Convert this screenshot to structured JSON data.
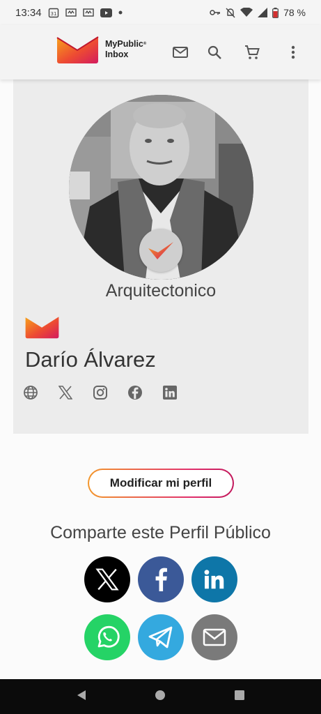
{
  "status_bar": {
    "time": "13:34",
    "battery": "78 %",
    "left_icons": [
      "calendar-icon",
      "notification-icon",
      "notification-icon",
      "youtube-icon",
      "dot-icon"
    ],
    "right_icons": [
      "key-icon",
      "mute-icon",
      "wifi-icon",
      "signal-icon",
      "battery-icon"
    ]
  },
  "app_bar": {
    "brand_line1": "MyPublic",
    "brand_reg": "®",
    "brand_line2": "Inbox",
    "actions": [
      "mail-icon",
      "search-icon",
      "cart-icon",
      "more-vert-icon"
    ]
  },
  "profile": {
    "category": "Arquitectonico",
    "name": "Darío Álvarez",
    "social_links": [
      "globe-icon",
      "x-icon",
      "instagram-icon",
      "facebook-icon",
      "linkedin-icon"
    ]
  },
  "edit_button": {
    "label": "Modificar mi perfil"
  },
  "share": {
    "title": "Comparte este Perfil Público",
    "buttons": [
      {
        "icon": "x-icon",
        "color": "#000000"
      },
      {
        "icon": "facebook-icon",
        "color": "#3b5998"
      },
      {
        "icon": "linkedin-icon",
        "color": "#0e76a8"
      },
      {
        "icon": "whatsapp-icon",
        "color": "#25d366"
      },
      {
        "icon": "telegram-icon",
        "color": "#34a9df"
      },
      {
        "icon": "email-icon",
        "color": "#7a7a7a"
      }
    ]
  },
  "colors": {
    "brand_red": "#e8383d",
    "brand_orange": "#f7a21b",
    "card_bg": "#ececec"
  },
  "nav_bar": [
    "back-icon",
    "home-icon",
    "recents-icon"
  ]
}
